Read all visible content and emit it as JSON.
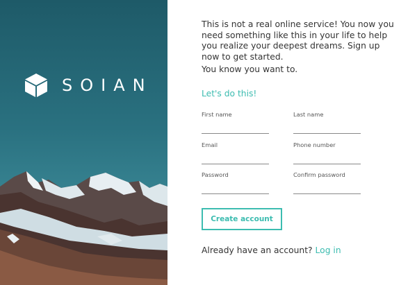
{
  "brand": {
    "name": "SOIAN",
    "logo_icon": "cube-icon"
  },
  "intro": {
    "paragraph": "This is not a real online service! You now you need something like this in your life to help you realize your deepest dreams. Sign up now to get started.",
    "tagline": "You know you want to.",
    "cta_heading": "Let's do this!"
  },
  "form": {
    "first_name": {
      "label": "First name",
      "value": "",
      "placeholder": ""
    },
    "last_name": {
      "label": "Last name",
      "value": "",
      "placeholder": ""
    },
    "email": {
      "label": "Email",
      "value": "",
      "placeholder": ""
    },
    "phone": {
      "label": "Phone number",
      "value": "",
      "placeholder": ""
    },
    "password": {
      "label": "Password",
      "value": "",
      "placeholder": ""
    },
    "confirm_password": {
      "label": "Confirm password",
      "value": "",
      "placeholder": ""
    },
    "submit_label": "Create account"
  },
  "login": {
    "prompt": "Already have an account?",
    "link_label": "Log in"
  },
  "colors": {
    "accent": "#3cbcb0",
    "hero_top": "#1e5a68",
    "hero_bottom": "#4c95a0",
    "text": "#333333"
  }
}
